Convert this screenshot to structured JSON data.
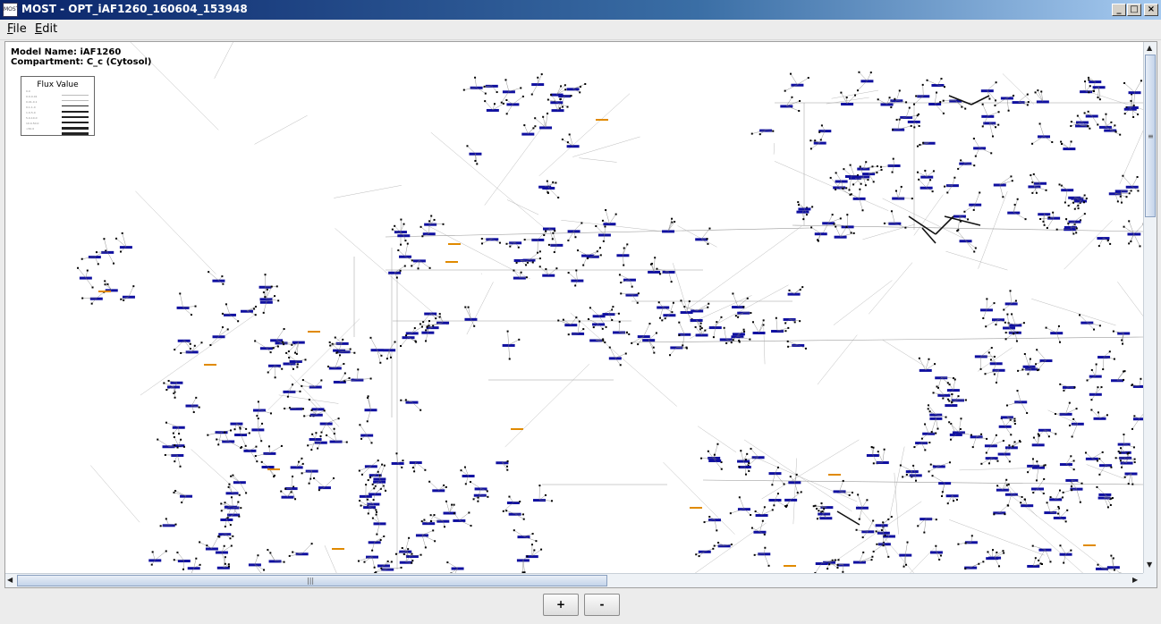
{
  "window": {
    "title": "MOST - OPT_iAF1260_160604_153948",
    "icon_label": "MOST",
    "controls": [
      "minimize",
      "maximize",
      "close"
    ]
  },
  "menu": [
    {
      "label": "File",
      "mnemonic": "F",
      "rest": "ile"
    },
    {
      "label": "Edit",
      "mnemonic": "E",
      "rest": "dit"
    }
  ],
  "canvas": {
    "model_name_line": "Model Name: iAF1260",
    "compartment_line": "Compartment: C_c (Cytosol)",
    "legend": {
      "title": "Flux Value",
      "rows": [
        "0.0",
        "0.0-0.01",
        "0.01-0.1",
        "0.1-1.0",
        "1.0-5.0",
        "5.0-10.0",
        "10.0-50.0",
        ">50.0"
      ]
    },
    "colors": {
      "reaction": "#1010a0",
      "edge": "#9a9a9a",
      "metabolite": "#000000",
      "highlight": "#e08a00"
    }
  },
  "scrollbars": {
    "vertical": {
      "position": 0.0,
      "grip": "≡"
    },
    "horizontal": {
      "position": 0.0,
      "grip": "|||"
    }
  },
  "zoom": {
    "in_label": "+",
    "out_label": "-"
  }
}
